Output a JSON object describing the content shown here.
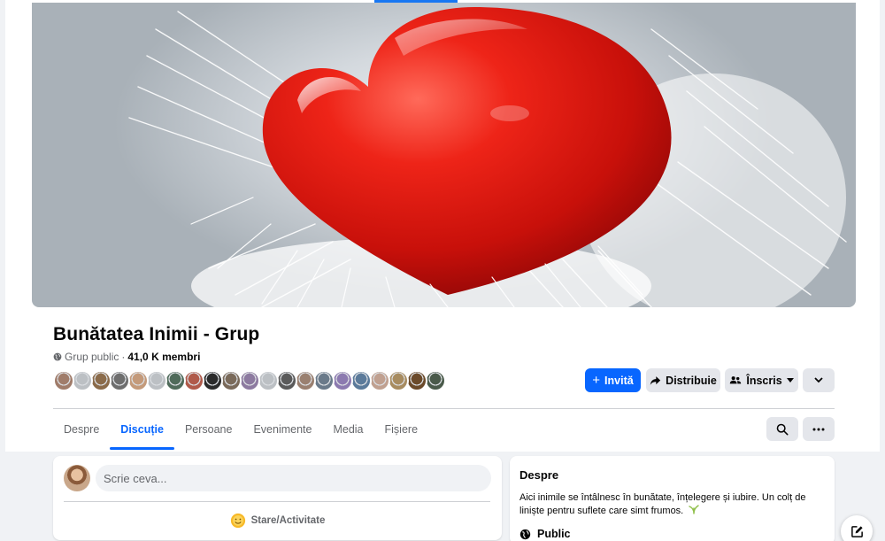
{
  "group": {
    "name": "Bunătatea Inimii - Grup",
    "privacy": "Grup public",
    "separator": "·",
    "members": "41,0 K membri"
  },
  "actions": {
    "invite": "Invită",
    "share": "Distribuie",
    "joined": "Înscris"
  },
  "tabs": [
    {
      "label": "Despre",
      "active": false
    },
    {
      "label": "Discuție",
      "active": true
    },
    {
      "label": "Persoane",
      "active": false
    },
    {
      "label": "Evenimente",
      "active": false
    },
    {
      "label": "Media",
      "active": false
    },
    {
      "label": "Fișiere",
      "active": false
    }
  ],
  "composer": {
    "placeholder": "Scrie ceva...",
    "status_label": "Stare/Activitate"
  },
  "about": {
    "title": "Despre",
    "description": "Aici inimile se întâlnesc în bunătate, înțelegere și iubire. Un colț de liniște pentru suflete care simt frumos.",
    "privacy": "Public"
  },
  "member_avatars": [
    "#a07c6a",
    "#bcc0c4",
    "#8b6b4a",
    "#6e6e6e",
    "#c49a7a",
    "#bcc0c4",
    "#4f6b5a",
    "#b05a4a",
    "#2b2b2b",
    "#7a6a5a",
    "#8d7aa0",
    "#bcc0c4",
    "#5a5a5a",
    "#9a8070",
    "#6a7a8a",
    "#8c7ab0",
    "#5b7a9a",
    "#c0a090",
    "#a88c60",
    "#6b4a2a",
    "#4a5a4a"
  ],
  "colors": {
    "accent": "#0866ff",
    "button_gray": "#e4e6eb",
    "background": "#f0f2f5"
  }
}
